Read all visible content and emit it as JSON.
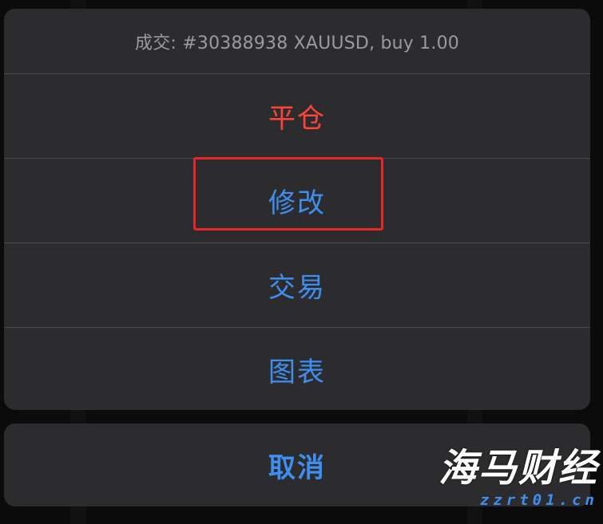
{
  "sheet": {
    "title": "成交: #30388938 XAUUSD, buy 1.00",
    "actions": [
      {
        "label": "平仓",
        "style": "destructive"
      },
      {
        "label": "修改",
        "style": "normal",
        "highlighted": true
      },
      {
        "label": "交易",
        "style": "normal"
      },
      {
        "label": "图表",
        "style": "normal"
      }
    ],
    "cancel_label": "取消"
  },
  "watermark": {
    "title": "海马财经",
    "url": "zzrt01.cn"
  },
  "colors": {
    "destructive": "#ff453a",
    "accent": "#3e8ff0",
    "highlight": "#e52727",
    "sheet_bg": "#2c2c2e"
  }
}
